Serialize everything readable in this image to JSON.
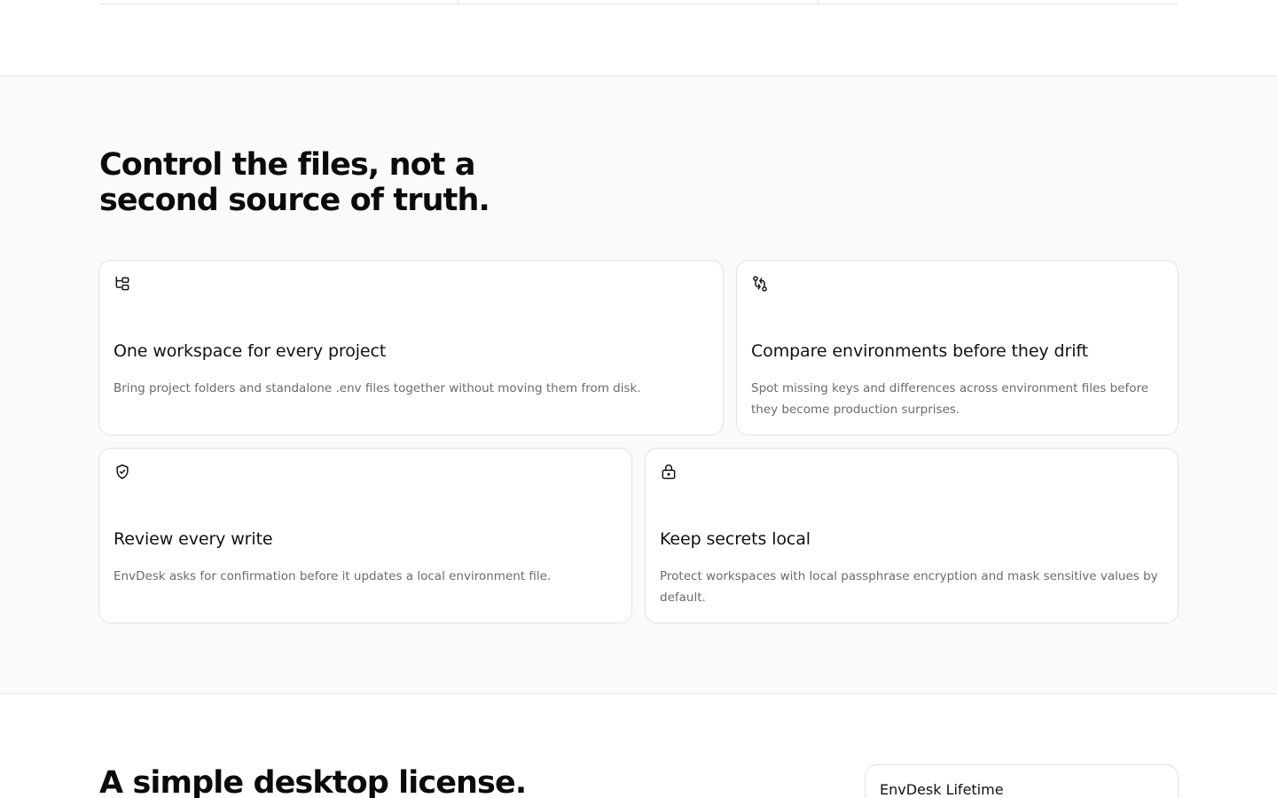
{
  "features": {
    "heading": "Control the files, not a second source of truth.",
    "cards": [
      {
        "icon": "folder-tree-icon",
        "title": "One workspace for every project",
        "description": "Bring project folders and standalone .env files together without moving them from disk."
      },
      {
        "icon": "git-compare-icon",
        "title": "Compare environments before they drift",
        "description": "Spot missing keys and differences across environment files before they become production surprises."
      },
      {
        "icon": "shield-check-icon",
        "title": "Review every write",
        "description": "EnvDesk asks for confirmation before it updates a local environment file."
      },
      {
        "icon": "lock-icon",
        "title": "Keep secrets local",
        "description": "Protect workspaces with local passphrase encryption and mask sensitive values by default."
      }
    ]
  },
  "license": {
    "heading": "A simple desktop license.",
    "plan_name": "EnvDesk Lifetime"
  }
}
